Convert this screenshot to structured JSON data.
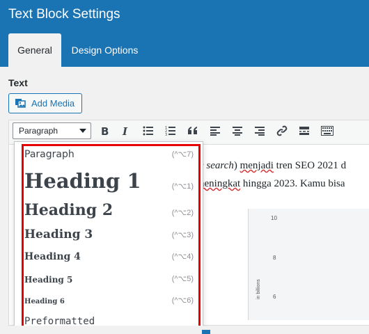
{
  "window": {
    "title": "Text Block Settings"
  },
  "tabs": [
    {
      "label": "General",
      "active": true
    },
    {
      "label": "Design Options",
      "active": false
    }
  ],
  "field": {
    "label": "Text"
  },
  "add_media": {
    "label": "Add Media"
  },
  "toolbar": {
    "format_selected": "Paragraph",
    "buttons": [
      "bold",
      "italic",
      "bullet-list",
      "numbered-list",
      "blockquote",
      "align-left",
      "align-center",
      "align-right",
      "link",
      "read-more",
      "toolbar-toggle"
    ]
  },
  "content": {
    "line1_italic": "e search",
    "line1_rest": ") ",
    "line1_underlined": "menjadi",
    "line1_tail": " tren SEO 2021 d",
    "line2_prefix": "",
    "line2_underlined": "neningkat",
    "line2_tail": " hingga 2023. Kamu bisa"
  },
  "chart": {
    "ticks": [
      "10",
      "8",
      "6"
    ],
    "axis_label": "in billions"
  },
  "dropdown": {
    "items": [
      {
        "label": "Paragraph",
        "shortcut": "(^⌥7)"
      },
      {
        "label": "Heading 1",
        "shortcut": "(^⌥1)"
      },
      {
        "label": "Heading 2",
        "shortcut": "(^⌥2)"
      },
      {
        "label": "Heading 3",
        "shortcut": "(^⌥3)"
      },
      {
        "label": "Heading 4",
        "shortcut": "(^⌥4)"
      },
      {
        "label": "Heading 5",
        "shortcut": "(^⌥5)"
      },
      {
        "label": "Heading 6",
        "shortcut": "(^⌥6)"
      },
      {
        "label": "Preformatted",
        "shortcut": ""
      }
    ]
  }
}
